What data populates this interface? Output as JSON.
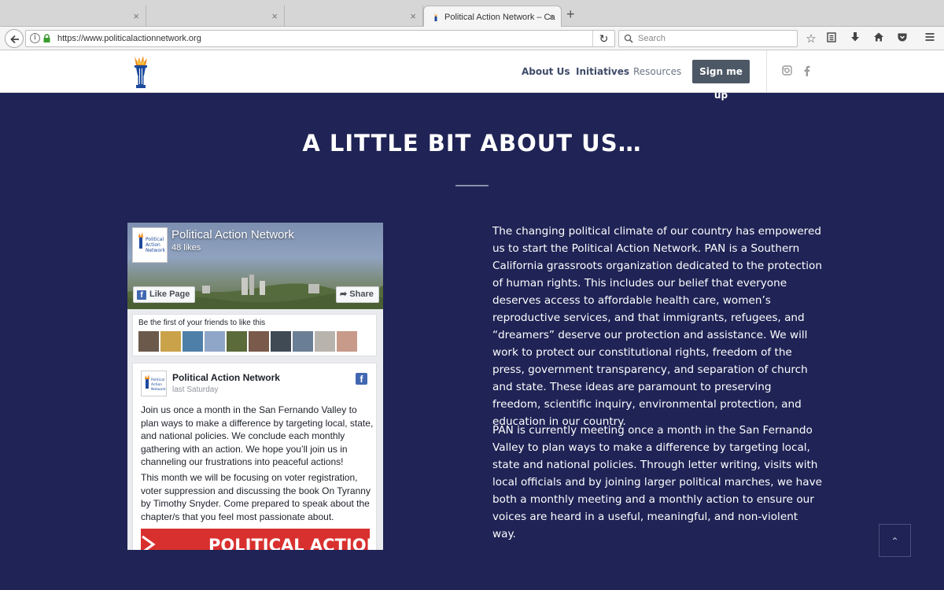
{
  "browser": {
    "tabs": [
      {
        "title": "",
        "active": false
      },
      {
        "title": "",
        "active": false
      },
      {
        "title": "",
        "active": false
      },
      {
        "title": "Political Action Network – Ca",
        "active": true
      }
    ],
    "new_tab_label": "+",
    "close_glyph": "×",
    "url": "https://www.politicalactionnetwork.org",
    "search_placeholder": "Search",
    "toolbar_icons": [
      "bookmark-star-icon",
      "reading-list-icon",
      "download-icon",
      "home-icon",
      "pocket-icon",
      "hamburger-menu-icon"
    ]
  },
  "site_header": {
    "nav": [
      {
        "label": "About Us"
      },
      {
        "label": "Initiatives"
      },
      {
        "label": "Resources"
      }
    ],
    "cta_label": "Sign me up",
    "social_icons": [
      "instagram-icon",
      "facebook-icon"
    ]
  },
  "section": {
    "title": "A LITTLE BIT ABOUT US…",
    "paragraphs": [
      "The changing political climate of our country has empowered us to start the Political Action Network. PAN is a Southern California grassroots organization dedicated to the protection of human rights. This includes our belief that everyone deserves access to affordable health care, women’s reproductive services, and that immigrants, refugees, and “dreamers” deserve our protection and assistance. We will work to protect our constitutional rights, freedom of the press, government transparency, and separation of church and state. These ideas are paramount to preserving freedom, scientific inquiry, environmental protection, and education in our country.",
      "PAN is currently meeting once a month in the San Fernando Valley to plan ways to make a difference by targeting local, state and national policies. Through letter writing, visits with local officials and by joining larger political marches, we have both a monthly meeting and a monthly action to ensure our voices are heard in a useful, meaningful, and non-violent way."
    ]
  },
  "facebook_widget": {
    "page_name": "Political Action Network",
    "likes": "48 likes",
    "like_button": "Like Page",
    "share_button": "Share",
    "friends_label": "Be the first of your friends to like this",
    "post": {
      "author": "Political Action Network",
      "time": "last Saturday",
      "paragraph1": "Join us once a month in the San Fernando Valley to plan ways to make a difference by targeting local, state, and national policies. We conclude each monthly gathering with an action. We hope you’ll join us in channeling our frustrations into peaceful actions!",
      "paragraph2": "This month we will be focusing on voter registration, voter suppression and discussing the book On Tyranny by Timothy Snyder. Come prepared to speak about the chapter/s that you feel most passionate about.",
      "banner_text": "POLITICAL ACTION"
    }
  },
  "scroll_top_glyph": "⌃",
  "colors": {
    "page_bg": "#1f2355",
    "cta_bg": "#4d5866",
    "fb_blue": "#4267b2",
    "banner_red": "#d8302e"
  }
}
